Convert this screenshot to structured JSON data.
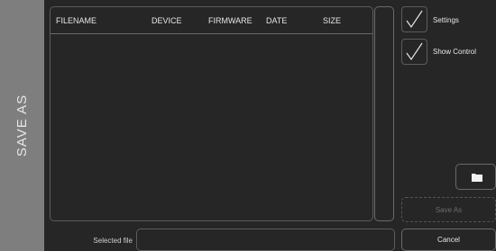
{
  "sidebar": {
    "title": "SAVE AS"
  },
  "file_list": {
    "columns": [
      "FILENAME",
      "DEVICE",
      "FIRMWARE",
      "DATE",
      "SIZE"
    ],
    "rows": []
  },
  "options": {
    "settings": {
      "label": "Settings",
      "checked": true
    },
    "show_control": {
      "label": "Show Control",
      "checked": true
    }
  },
  "buttons": {
    "folder_icon": "folder-icon",
    "save_as": "Save As",
    "cancel": "Cancel"
  },
  "selected_file": {
    "label": "Selected file",
    "value": ""
  },
  "colors": {
    "background": "#262626",
    "sidebar": "#7e7e7e",
    "border": "#5c5c5c",
    "text": "#e6e6e6",
    "disabled_text": "#6d6d6d"
  }
}
